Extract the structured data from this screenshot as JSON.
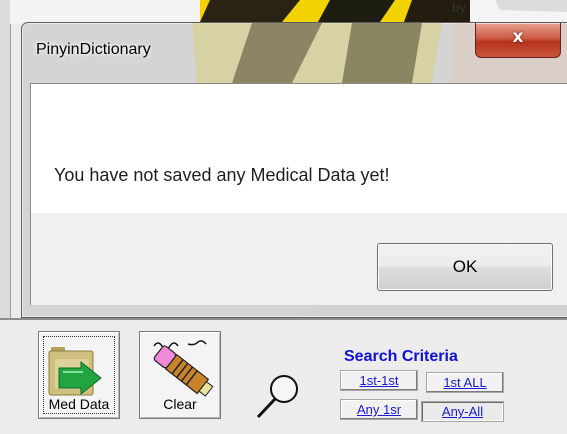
{
  "dialog": {
    "title": "PinyinDictionary",
    "close_label": "x",
    "message": "You have not saved any Medical Data yet!",
    "ok_label": "OK"
  },
  "background_app": {
    "toolbar": {
      "med_data_label": "Med Data",
      "clear_label": "Clear",
      "med_data_icon": "folder-green-arrow-icon",
      "clear_icon": "eraser-icon",
      "search_icon": "magnifier-icon"
    },
    "search_criteria": {
      "title": "Search Criteria",
      "buttons": [
        "1st-1st",
        "1st ALL",
        "Any 1sr",
        "Any-All"
      ],
      "selected": "Any-All"
    },
    "banner_fragment": "by"
  },
  "colors": {
    "criteria_title": "#1010d8",
    "criteria_button_text": "#1a1ad6",
    "close_button": "#c0452e",
    "background_art_yellow": "#f2d200",
    "background_art_dark": "#1c1c10"
  }
}
